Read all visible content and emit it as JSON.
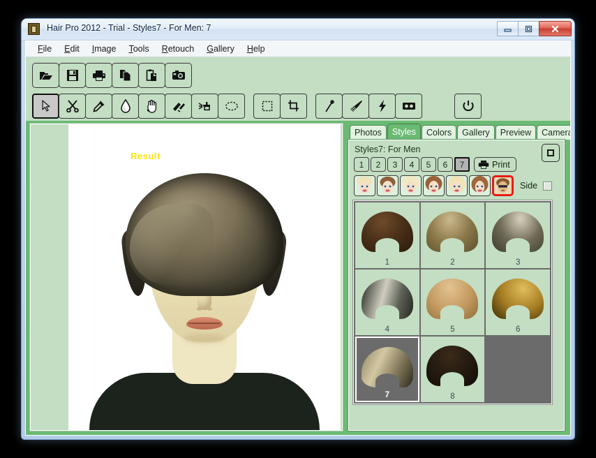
{
  "window": {
    "title": "Hair Pro 2012 - Trial - Styles7 - For Men: 7",
    "app_icon": "app-picture-icon",
    "minimize_label": "Minimize",
    "maximize_label": "Maximize",
    "close_label": "Close"
  },
  "menu": {
    "items": [
      {
        "label": "File",
        "accel": "F"
      },
      {
        "label": "Edit",
        "accel": "E"
      },
      {
        "label": "Image",
        "accel": "I"
      },
      {
        "label": "Tools",
        "accel": "T"
      },
      {
        "label": "Retouch",
        "accel": "R"
      },
      {
        "label": "Gallery",
        "accel": "G"
      },
      {
        "label": "Help",
        "accel": "H"
      }
    ]
  },
  "toolbar_file": {
    "buttons": [
      {
        "name": "open-folder-icon",
        "tip": "Open"
      },
      {
        "name": "save-floppy-icon",
        "tip": "Save"
      },
      {
        "name": "printer-icon",
        "tip": "Print"
      },
      {
        "name": "copy-icon",
        "tip": "Copy"
      },
      {
        "name": "paste-clipboard-icon",
        "tip": "Paste"
      },
      {
        "name": "camera-icon",
        "tip": "Camera"
      }
    ]
  },
  "toolbar_tools": {
    "buttons": [
      {
        "name": "arrow-pointer-icon",
        "tip": "Select",
        "selected": true
      },
      {
        "name": "scissors-icon",
        "tip": "Cut"
      },
      {
        "name": "eyedropper-icon",
        "tip": "Pick color"
      },
      {
        "name": "water-drop-icon",
        "tip": "Blur"
      },
      {
        "name": "hand-icon",
        "tip": "Hand"
      },
      {
        "name": "makeup-brush-icon",
        "tip": "Makeup"
      },
      {
        "name": "spray-icon",
        "tip": "Spray"
      },
      {
        "name": "lasso-icon",
        "tip": "Lasso"
      },
      {
        "name": "marquee-select-icon",
        "tip": "Marquee"
      },
      {
        "name": "crop-icon",
        "tip": "Crop"
      },
      {
        "name": "magic-wand-icon",
        "tip": "Magic wand"
      },
      {
        "name": "paint-brush-icon",
        "tip": "Brush"
      },
      {
        "name": "lightning-icon",
        "tip": "Auto"
      },
      {
        "name": "tape-icon",
        "tip": "Record"
      },
      {
        "name": "power-icon",
        "tip": "Exit"
      }
    ]
  },
  "canvas": {
    "result_label": "Result",
    "photo_alt": "woman-portrait-with-applied-hairstyle"
  },
  "tabs": [
    {
      "label": "Photos",
      "selected": false
    },
    {
      "label": "Styles",
      "selected": true
    },
    {
      "label": "Colors",
      "selected": false
    },
    {
      "label": "Gallery",
      "selected": false
    },
    {
      "label": "Preview",
      "selected": false
    },
    {
      "label": "Camera",
      "selected": false
    }
  ],
  "styles_panel": {
    "title": "Styles7: For Men",
    "corner_icon": "restore-window-icon",
    "page_buttons": [
      {
        "label": "1",
        "selected": false
      },
      {
        "label": "2",
        "selected": false
      },
      {
        "label": "3",
        "selected": false
      },
      {
        "label": "4",
        "selected": false
      },
      {
        "label": "5",
        "selected": false
      },
      {
        "label": "6",
        "selected": false
      },
      {
        "label": "7",
        "selected": true
      }
    ],
    "print_label": "Print",
    "print_icon": "printer-icon",
    "category_buttons": [
      {
        "name": "face-short-blonde",
        "selected": false,
        "hair": "#efe3b8",
        "skin": "#f4e0c6"
      },
      {
        "name": "face-bob-brown",
        "selected": false,
        "hair": "#8d5f3a",
        "skin": "#f4e0c6"
      },
      {
        "name": "face-long-blonde",
        "selected": false,
        "hair": "#f2e9c2",
        "skin": "#f4e0c6"
      },
      {
        "name": "face-wavy-brown",
        "selected": false,
        "hair": "#9a6239",
        "skin": "#f4e0c6"
      },
      {
        "name": "face-straight-blonde",
        "selected": false,
        "hair": "#f0e4b4",
        "skin": "#f4e0c6"
      },
      {
        "name": "face-long-auburn",
        "selected": false,
        "hair": "#a0663c",
        "skin": "#f4e0c6"
      },
      {
        "name": "face-men-sunglasses",
        "selected": true,
        "hair": "#8a5a2c",
        "skin": "#e3b98a"
      }
    ],
    "side_label": "Side",
    "side_checked": false,
    "thumbnails": [
      {
        "num": "1",
        "selected": false,
        "color_top": "#6e4b2a",
        "color_mid": "#4a3018",
        "color_bot": "#2a1a0c"
      },
      {
        "num": "2",
        "selected": false,
        "color_top": "#cbb98e",
        "color_mid": "#8d7a4c",
        "color_bot": "#5d4f2c"
      },
      {
        "num": "3",
        "selected": false,
        "color_top": "#d8d2bd",
        "color_mid": "#6f6a55",
        "color_bot": "#3b3a2e"
      },
      {
        "num": "4",
        "selected": false,
        "color_top": "#cfcdc0",
        "color_mid": "#5f6257",
        "color_bot": "#23271f"
      },
      {
        "num": "5",
        "selected": false,
        "color_top": "#e3c392",
        "color_mid": "#c39a60",
        "color_bot": "#8e6c3a"
      },
      {
        "num": "6",
        "selected": false,
        "color_top": "#e0bd5c",
        "color_mid": "#a87f24",
        "color_bot": "#3b2c06"
      },
      {
        "num": "7",
        "selected": true,
        "color_top": "#d4c8a4",
        "color_mid": "#8e8363",
        "color_bot": "#2c2a1e"
      },
      {
        "num": "8",
        "selected": false,
        "color_top": "#3b2a1a",
        "color_mid": "#241a10",
        "color_bot": "#120c06"
      }
    ]
  },
  "colors": {
    "window_frame": "#b3cbe8",
    "panel_green": "#c3dec3",
    "client_green": "#6bba73",
    "selection_red": "#e81c16",
    "result_yellow": "#ffe400",
    "grid_gray": "#6b6b6b"
  }
}
